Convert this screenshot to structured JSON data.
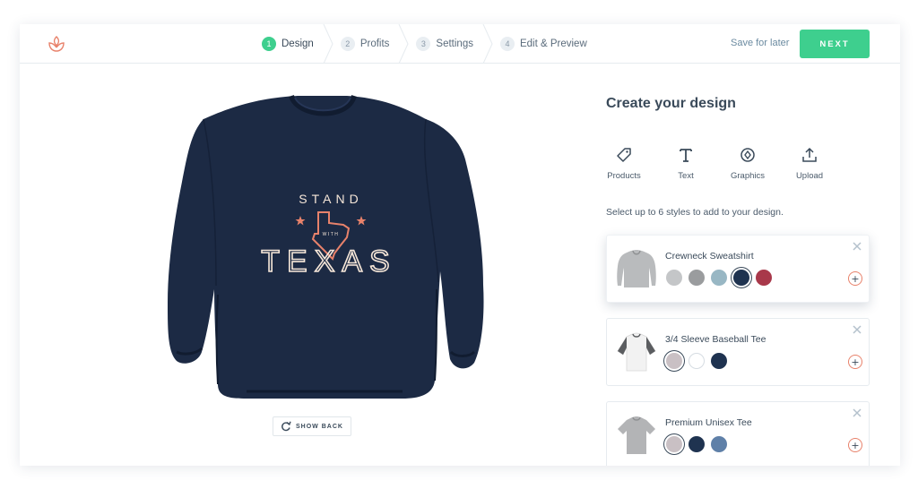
{
  "header": {
    "steps": [
      {
        "num": "1",
        "label": "Design",
        "active": true
      },
      {
        "num": "2",
        "label": "Profits",
        "active": false
      },
      {
        "num": "3",
        "label": "Settings",
        "active": false
      },
      {
        "num": "4",
        "label": "Edit & Preview",
        "active": false
      }
    ],
    "save_later": "Save for later",
    "next_label": "NEXT"
  },
  "preview": {
    "design_text": [
      "STAND",
      "WITH",
      "TEXAS"
    ],
    "show_back_label": "SHOW BACK"
  },
  "panel": {
    "title": "Create your design",
    "tools": [
      {
        "label": "Products",
        "icon": "tag-icon"
      },
      {
        "label": "Text",
        "icon": "text-icon"
      },
      {
        "label": "Graphics",
        "icon": "graphics-icon"
      },
      {
        "label": "Upload",
        "icon": "upload-icon"
      }
    ],
    "instruction": "Select up to 6 styles to add to your design.",
    "products": [
      {
        "name": "Crewneck Sweatshirt",
        "colors": [
          "#c4c6c8",
          "#9a9c9e",
          "#98b7c4",
          "#1f3350",
          "#a8384a"
        ],
        "selected_index": 3
      },
      {
        "name": "3/4 Sleeve Baseball Tee",
        "colors": [
          "#c9c0c4",
          "#ffffff",
          "#1f3350"
        ],
        "selected_index": 0
      },
      {
        "name": "Premium Unisex Tee",
        "colors": [
          "#c9c0c4",
          "#1f3350",
          "#5f80a8"
        ],
        "selected_index": 0
      }
    ]
  },
  "colors": {
    "accent": "#3ecf8e",
    "garment": "#1c2a44",
    "print_cream": "#f5e6d8",
    "print_orange": "#e8826b"
  }
}
